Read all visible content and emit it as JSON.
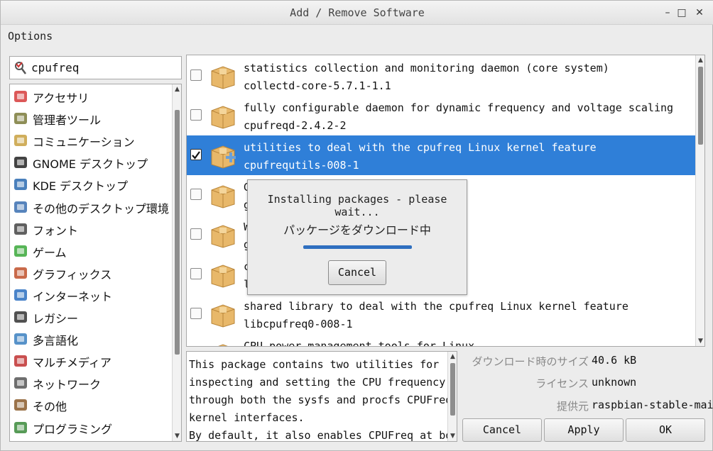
{
  "window": {
    "title": "Add / Remove Software"
  },
  "menu": {
    "options": "Options"
  },
  "search": {
    "value": "cpufreq"
  },
  "categories": [
    {
      "label": "アクセサリ",
      "icon": "accessories-icon",
      "color": "#d63b3b"
    },
    {
      "label": "管理者ツール",
      "icon": "admin-tools-icon",
      "color": "#7a7a3a"
    },
    {
      "label": "コミュニケーション",
      "icon": "communication-icon",
      "color": "#c8a040"
    },
    {
      "label": "GNOME デスクトップ",
      "icon": "gnome-icon",
      "color": "#222222"
    },
    {
      "label": "KDE デスクトップ",
      "icon": "kde-icon",
      "color": "#2a6ab0"
    },
    {
      "label": "その他のデスクトップ環境",
      "icon": "desktop-icon",
      "color": "#3a6fb0"
    },
    {
      "label": "フォント",
      "icon": "font-icon",
      "color": "#444444"
    },
    {
      "label": "ゲーム",
      "icon": "game-icon",
      "color": "#3aa83a"
    },
    {
      "label": "グラフィックス",
      "icon": "graphics-icon",
      "color": "#c0502a"
    },
    {
      "label": "インターネット",
      "icon": "internet-icon",
      "color": "#2a6fc0"
    },
    {
      "label": "レガシー",
      "icon": "floppy-icon",
      "color": "#333333"
    },
    {
      "label": "多言語化",
      "icon": "language-icon",
      "color": "#3a7fc0"
    },
    {
      "label": "マルチメディア",
      "icon": "multimedia-icon",
      "color": "#c03030"
    },
    {
      "label": "ネットワーク",
      "icon": "network-icon",
      "color": "#555555"
    },
    {
      "label": "その他",
      "icon": "other-icon",
      "color": "#8a5a2a"
    },
    {
      "label": "プログラミング",
      "icon": "programming-icon",
      "color": "#3a8a3a"
    }
  ],
  "packages": [
    {
      "desc": "statistics collection and monitoring daemon (core system)",
      "name": "collectd-core-5.7.1-1.1",
      "checked": false,
      "selected": false
    },
    {
      "desc": "fully configurable daemon for dynamic frequency and voltage scaling",
      "name": "cpufreqd-2.4.2-2",
      "checked": false,
      "selected": false
    },
    {
      "desc": "utilities to deal with the cpufreq Linux kernel feature",
      "name": "cpufrequtils-008-1",
      "checked": true,
      "selected": true
    },
    {
      "desc": "G",
      "name": "g",
      "checked": false,
      "selected": false
    },
    {
      "desc": "W                                             inary files",
      "name": "g",
      "checked": false,
      "selected": false
    },
    {
      "desc": "c                                             freq Linux kernel feature",
      "name": "l",
      "checked": false,
      "selected": false
    },
    {
      "desc": "shared library to deal with the cpufreq Linux kernel feature",
      "name": "libcpufreq0-008-1",
      "checked": false,
      "selected": false
    },
    {
      "desc": "CPU power management tools for Linux",
      "name": "",
      "checked": false,
      "selected": false
    }
  ],
  "details": {
    "text": "This package contains two utilities for\ninspecting and setting the CPU frequency\nthrough both the sysfs and procfs CPUFreq\nkernel interfaces.\nBy default, it also enables CPUFreq at boot",
    "size_label": "ダウンロード時のサイズ",
    "size_value": "40.6 kB",
    "license_label": "ライセンス",
    "license_value": "unknown",
    "source_label": "提供元",
    "source_value": "raspbian-stable-main"
  },
  "buttons": {
    "cancel": "Cancel",
    "apply": "Apply",
    "ok": "OK"
  },
  "dialog": {
    "message": "Installing packages - please wait...",
    "status": "パッケージをダウンロード中",
    "progress": 1.0,
    "cancel": "Cancel"
  },
  "colors": {
    "selection": "#2f7fd8",
    "package_box": "#e8b86a"
  }
}
